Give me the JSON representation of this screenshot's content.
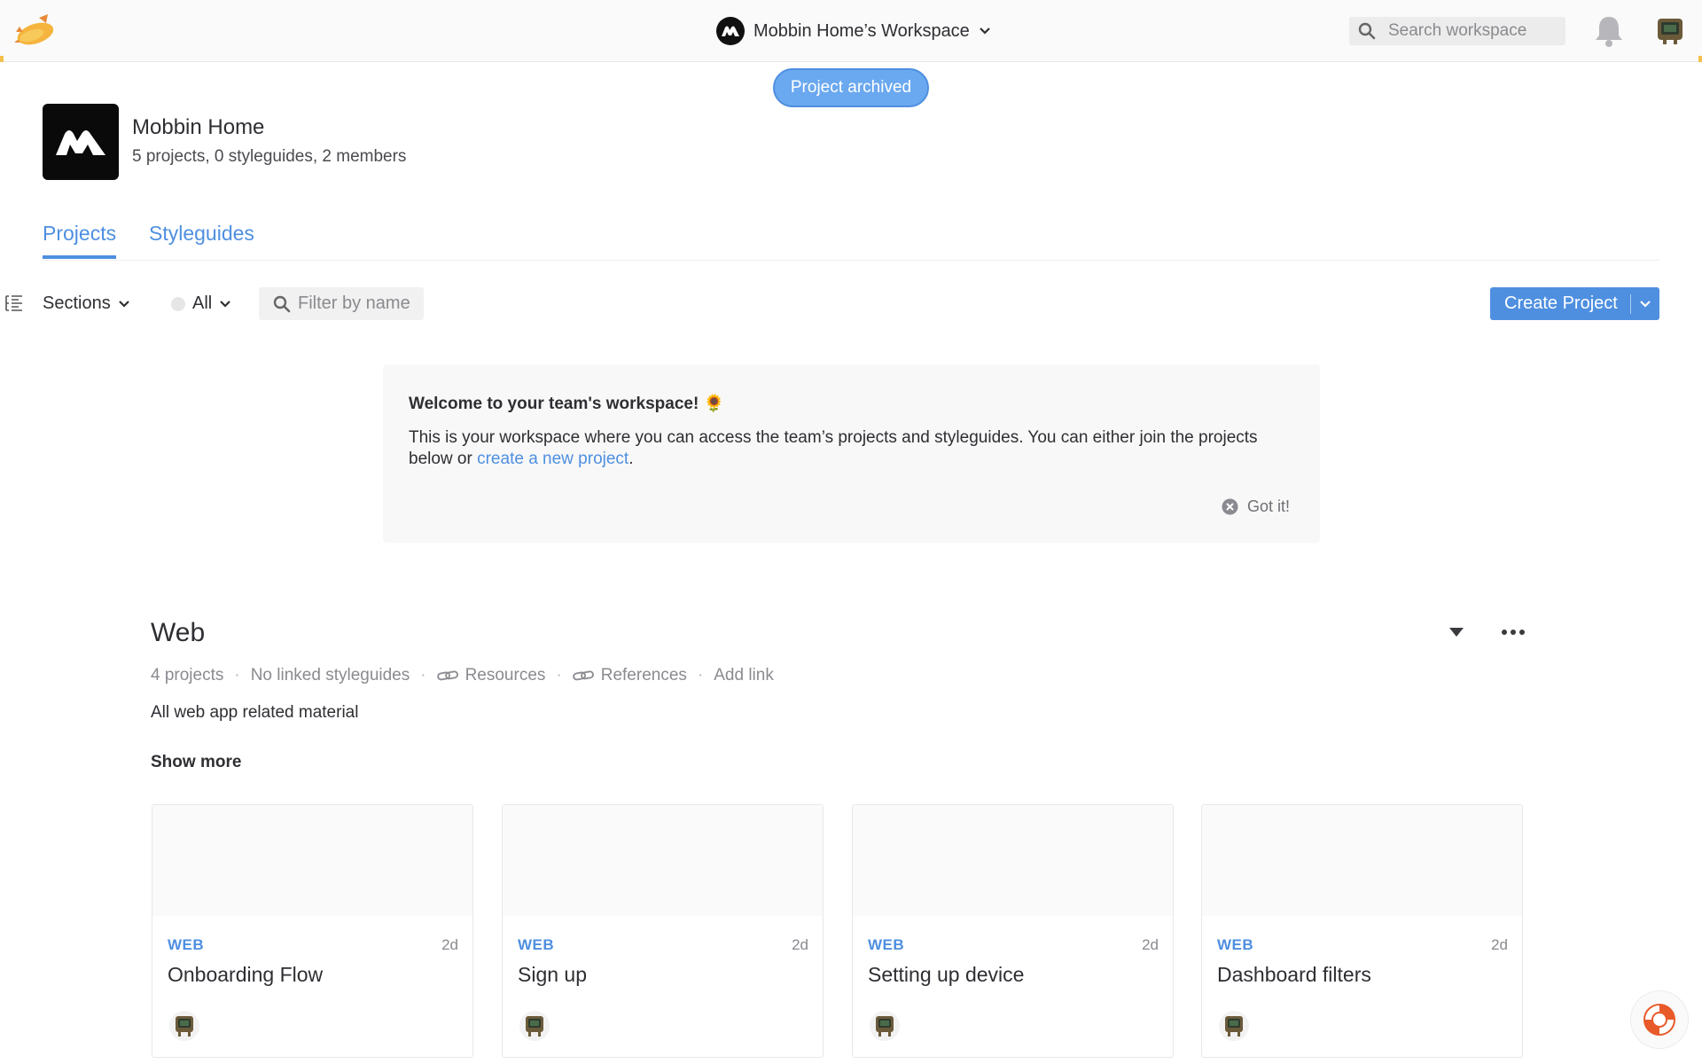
{
  "topbar": {
    "workspace_name": "Mobbin Home’s Workspace",
    "search_placeholder": "Search workspace"
  },
  "toast": {
    "message": "Project archived"
  },
  "workspace": {
    "name": "Mobbin Home",
    "stats": "5 projects, 0 styleguides, 2 members"
  },
  "tabs": [
    {
      "label": "Projects",
      "active": true
    },
    {
      "label": "Styleguides",
      "active": false
    }
  ],
  "toolbar": {
    "sections_label": "Sections",
    "filter_all_label": "All",
    "filter_placeholder": "Filter by name",
    "create_label": "Create Project"
  },
  "welcome": {
    "title": "Welcome to your team's workspace! 🌻",
    "body_before": "This is your workspace where you can access the team’s projects and styleguides. You can either join the projects below or ",
    "link_text": "create a new project",
    "body_after": ".",
    "dismiss_label": "Got it!"
  },
  "section": {
    "title": "Web",
    "meta": {
      "projects_count": "4 projects",
      "styleguides": "No linked styleguides",
      "resources": "Resources",
      "references": "References",
      "add_link": "Add link"
    },
    "description": "All web app related material",
    "show_more": "Show more",
    "projects": [
      {
        "tag": "WEB",
        "time": "2d",
        "title": "Onboarding Flow"
      },
      {
        "tag": "WEB",
        "time": "2d",
        "title": "Sign up"
      },
      {
        "tag": "WEB",
        "time": "2d",
        "title": "Setting up device"
      },
      {
        "tag": "WEB",
        "time": "2d",
        "title": "Dashboard filters"
      }
    ]
  },
  "colors": {
    "accent": "#4e8fe0",
    "toast": "#6aa8ef",
    "brand_yellow": "#f5c04a"
  },
  "icons": {
    "app_logo": "zeplin-blimp-icon",
    "search": "search-icon",
    "notifications": "bell-icon",
    "help": "lifebuoy-icon"
  }
}
